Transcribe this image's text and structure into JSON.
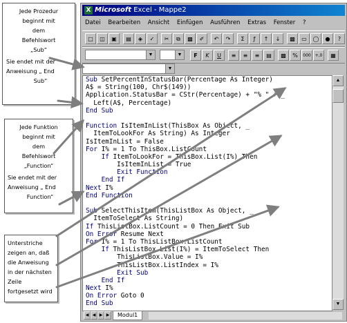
{
  "annotations": {
    "note1": [
      "Jede Prozedur",
      "beginnt mit",
      "dem",
      "Befehlswort",
      "„Sub“",
      "Sie endet mit der",
      "Anweisung „ End",
      "Sub“"
    ],
    "note2": [
      "Jede Funktion",
      "beginnt mit",
      "dem",
      "Befehlswort",
      "„Function“",
      "Sie endet mit der",
      "Anweisung „ End",
      "Function“"
    ],
    "note3": [
      "Unterstriche",
      "zeigen an, daß",
      "die Anweisung",
      "in der nächsten",
      "Zeile",
      "fortgesetzt wird"
    ]
  },
  "window": {
    "app_icon": "X",
    "brand": "Microsoft",
    "title_rest": " Excel - Mappe2"
  },
  "menu": [
    "Datei",
    "Bearbeiten",
    "Ansicht",
    "Einfügen",
    "Ausführen",
    "Extras",
    "Fenster",
    "?"
  ],
  "toolbar2": {
    "bold": "F",
    "italic": "K",
    "underline": "U",
    "comma": ",",
    "percent": "%",
    "thousands": "000",
    "inc_decimals": "+,0"
  },
  "code_lines": [
    "Sub SetPercentInStatusBar(Percentage As Integer)",
    "A$ = String(100, Chr$(149))",
    "Application.StatusBar = CStr(Percentage) + \"% \" + _",
    "  Left(A$, Percentage)",
    "End Sub",
    "",
    "Function IsItemInList(ThisBox As Object, _",
    "  ItemToLookFor As String) As Integer",
    "IsItemInList = False",
    "For I% = 1 To ThisBox.ListCount",
    "    If ItemToLookFor = ThisBox.List(I%) Then",
    "        IsItemInList = True",
    "        Exit Function",
    "    End If",
    "Next I%",
    "End Function",
    "",
    "Sub SelectThisItem(ThisListBox As Object, _",
    "  ItemToSelect As String)",
    "If ThisListBox.ListCount = 0 Then Exit Sub",
    "On Error Resume Next",
    "For I% = 1 To ThisListBox.ListCount",
    "    If ThisListBox.List(I%) = ItemToSelect Then",
    "        ThisListBox.Value = I%",
    "        ThisListBox.ListIndex = I%",
    "        Exit Sub",
    "    End If",
    "Next I%",
    "On Error Goto 0",
    "End Sub"
  ],
  "sheet_tab": "Modul1",
  "colors": {
    "title_start": "#000080",
    "title_end": "#1084d0",
    "keyword": "#000080",
    "arrow": "#7f7f7f"
  },
  "icons": [
    "new-icon",
    "open-icon",
    "save-icon",
    "print-icon",
    "preview-icon",
    "spelling-icon",
    "cut-icon",
    "copy-icon",
    "paste-icon",
    "format-painter-icon",
    "undo-icon",
    "redo-icon",
    "autosum-icon",
    "function-wizard-icon",
    "sort-ascending-icon",
    "sort-descending-icon"
  ]
}
